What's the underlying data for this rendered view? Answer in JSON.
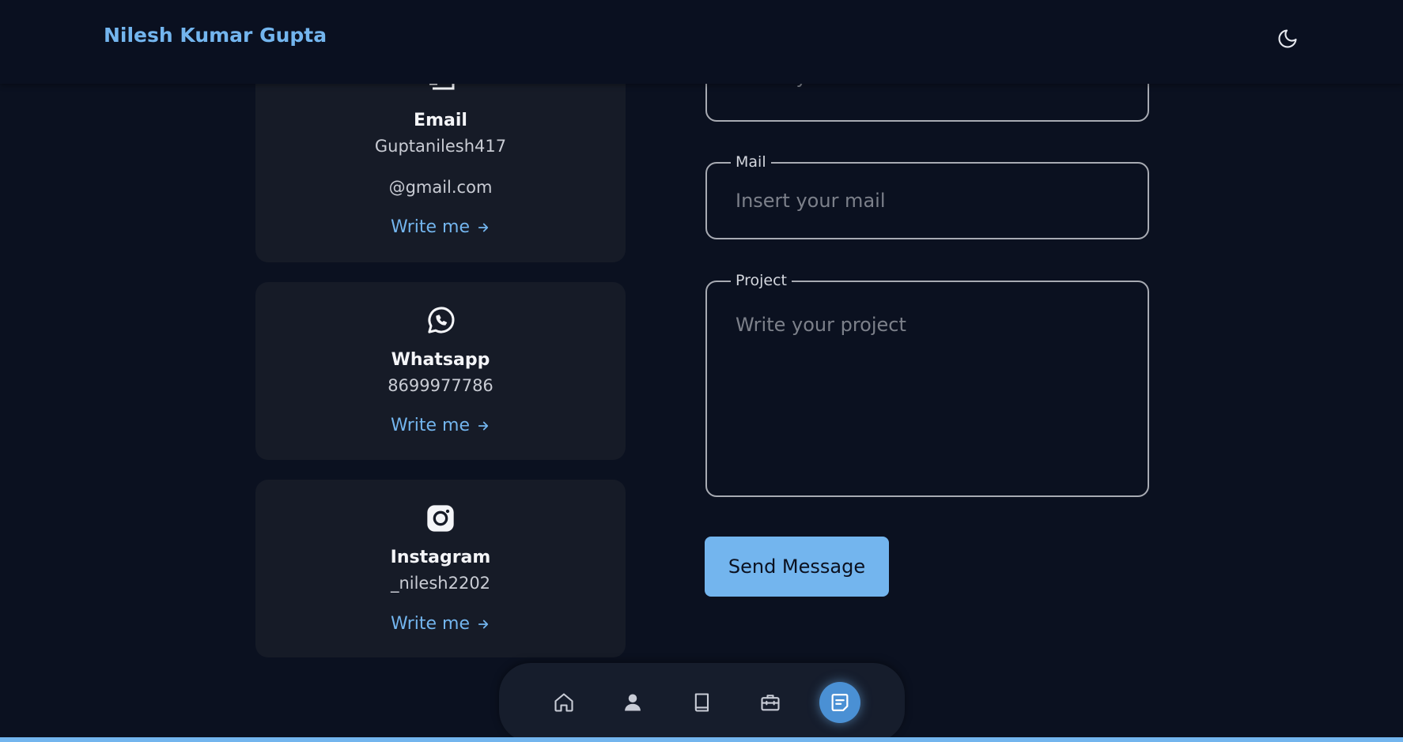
{
  "header": {
    "brand": "Nilesh Kumar Gupta",
    "theme_icon": "moon-icon"
  },
  "contacts": [
    {
      "icon": "email-icon",
      "title": "Email",
      "value_line1": "Guptanilesh417",
      "value_line2": "@gmail.com",
      "link": "Write me"
    },
    {
      "icon": "whatsapp-icon",
      "title": "Whatsapp",
      "value_line1": "8699977786",
      "link": "Write me"
    },
    {
      "icon": "instagram-icon",
      "title": "Instagram",
      "value_line1": "_nilesh2202",
      "link": "Write me"
    }
  ],
  "form": {
    "name_placeholder": "Insert your name",
    "mail_label": "Mail",
    "mail_placeholder": "Insert your mail",
    "project_label": "Project",
    "project_placeholder": "Write your project",
    "send_label": "Send Message"
  },
  "nav": {
    "items": [
      {
        "icon": "home-icon",
        "active": false
      },
      {
        "icon": "user-icon",
        "active": false
      },
      {
        "icon": "book-icon",
        "active": false
      },
      {
        "icon": "briefcase-icon",
        "active": false
      },
      {
        "icon": "message-icon",
        "active": true
      }
    ]
  },
  "colors": {
    "accent": "#73b5ee",
    "background": "#0b1120",
    "card": "#161b27"
  }
}
